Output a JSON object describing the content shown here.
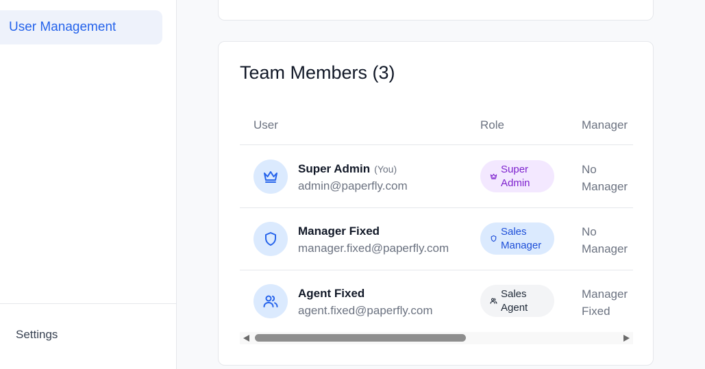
{
  "sidebar": {
    "active_item": "User Management",
    "settings_label": "Settings"
  },
  "team": {
    "title": "Team Members (3)",
    "columns": {
      "user": "User",
      "role": "Role",
      "manager": "Manager"
    },
    "members": [
      {
        "name": "Super Admin",
        "you_label": "(You)",
        "email": "admin@paperfly.com",
        "role": [
          "Super",
          "Admin"
        ],
        "manager": [
          "No",
          "Manager"
        ],
        "icon": "crown-icon"
      },
      {
        "name": "Manager Fixed",
        "email": "manager.fixed@paperfly.com",
        "role": [
          "Sales",
          "Manager"
        ],
        "manager": [
          "No",
          "Manager"
        ],
        "icon": "shield-icon"
      },
      {
        "name": "Agent Fixed",
        "email": "agent.fixed@paperfly.com",
        "role": [
          "Sales",
          "Agent"
        ],
        "manager": [
          "Manager",
          "Fixed"
        ],
        "icon": "users-icon"
      }
    ]
  },
  "colors": {
    "accent": "#2563eb",
    "super_admin_badge": "#f3e8ff",
    "sales_manager_badge": "#dbeafe",
    "sales_agent_badge": "#f3f4f6"
  }
}
